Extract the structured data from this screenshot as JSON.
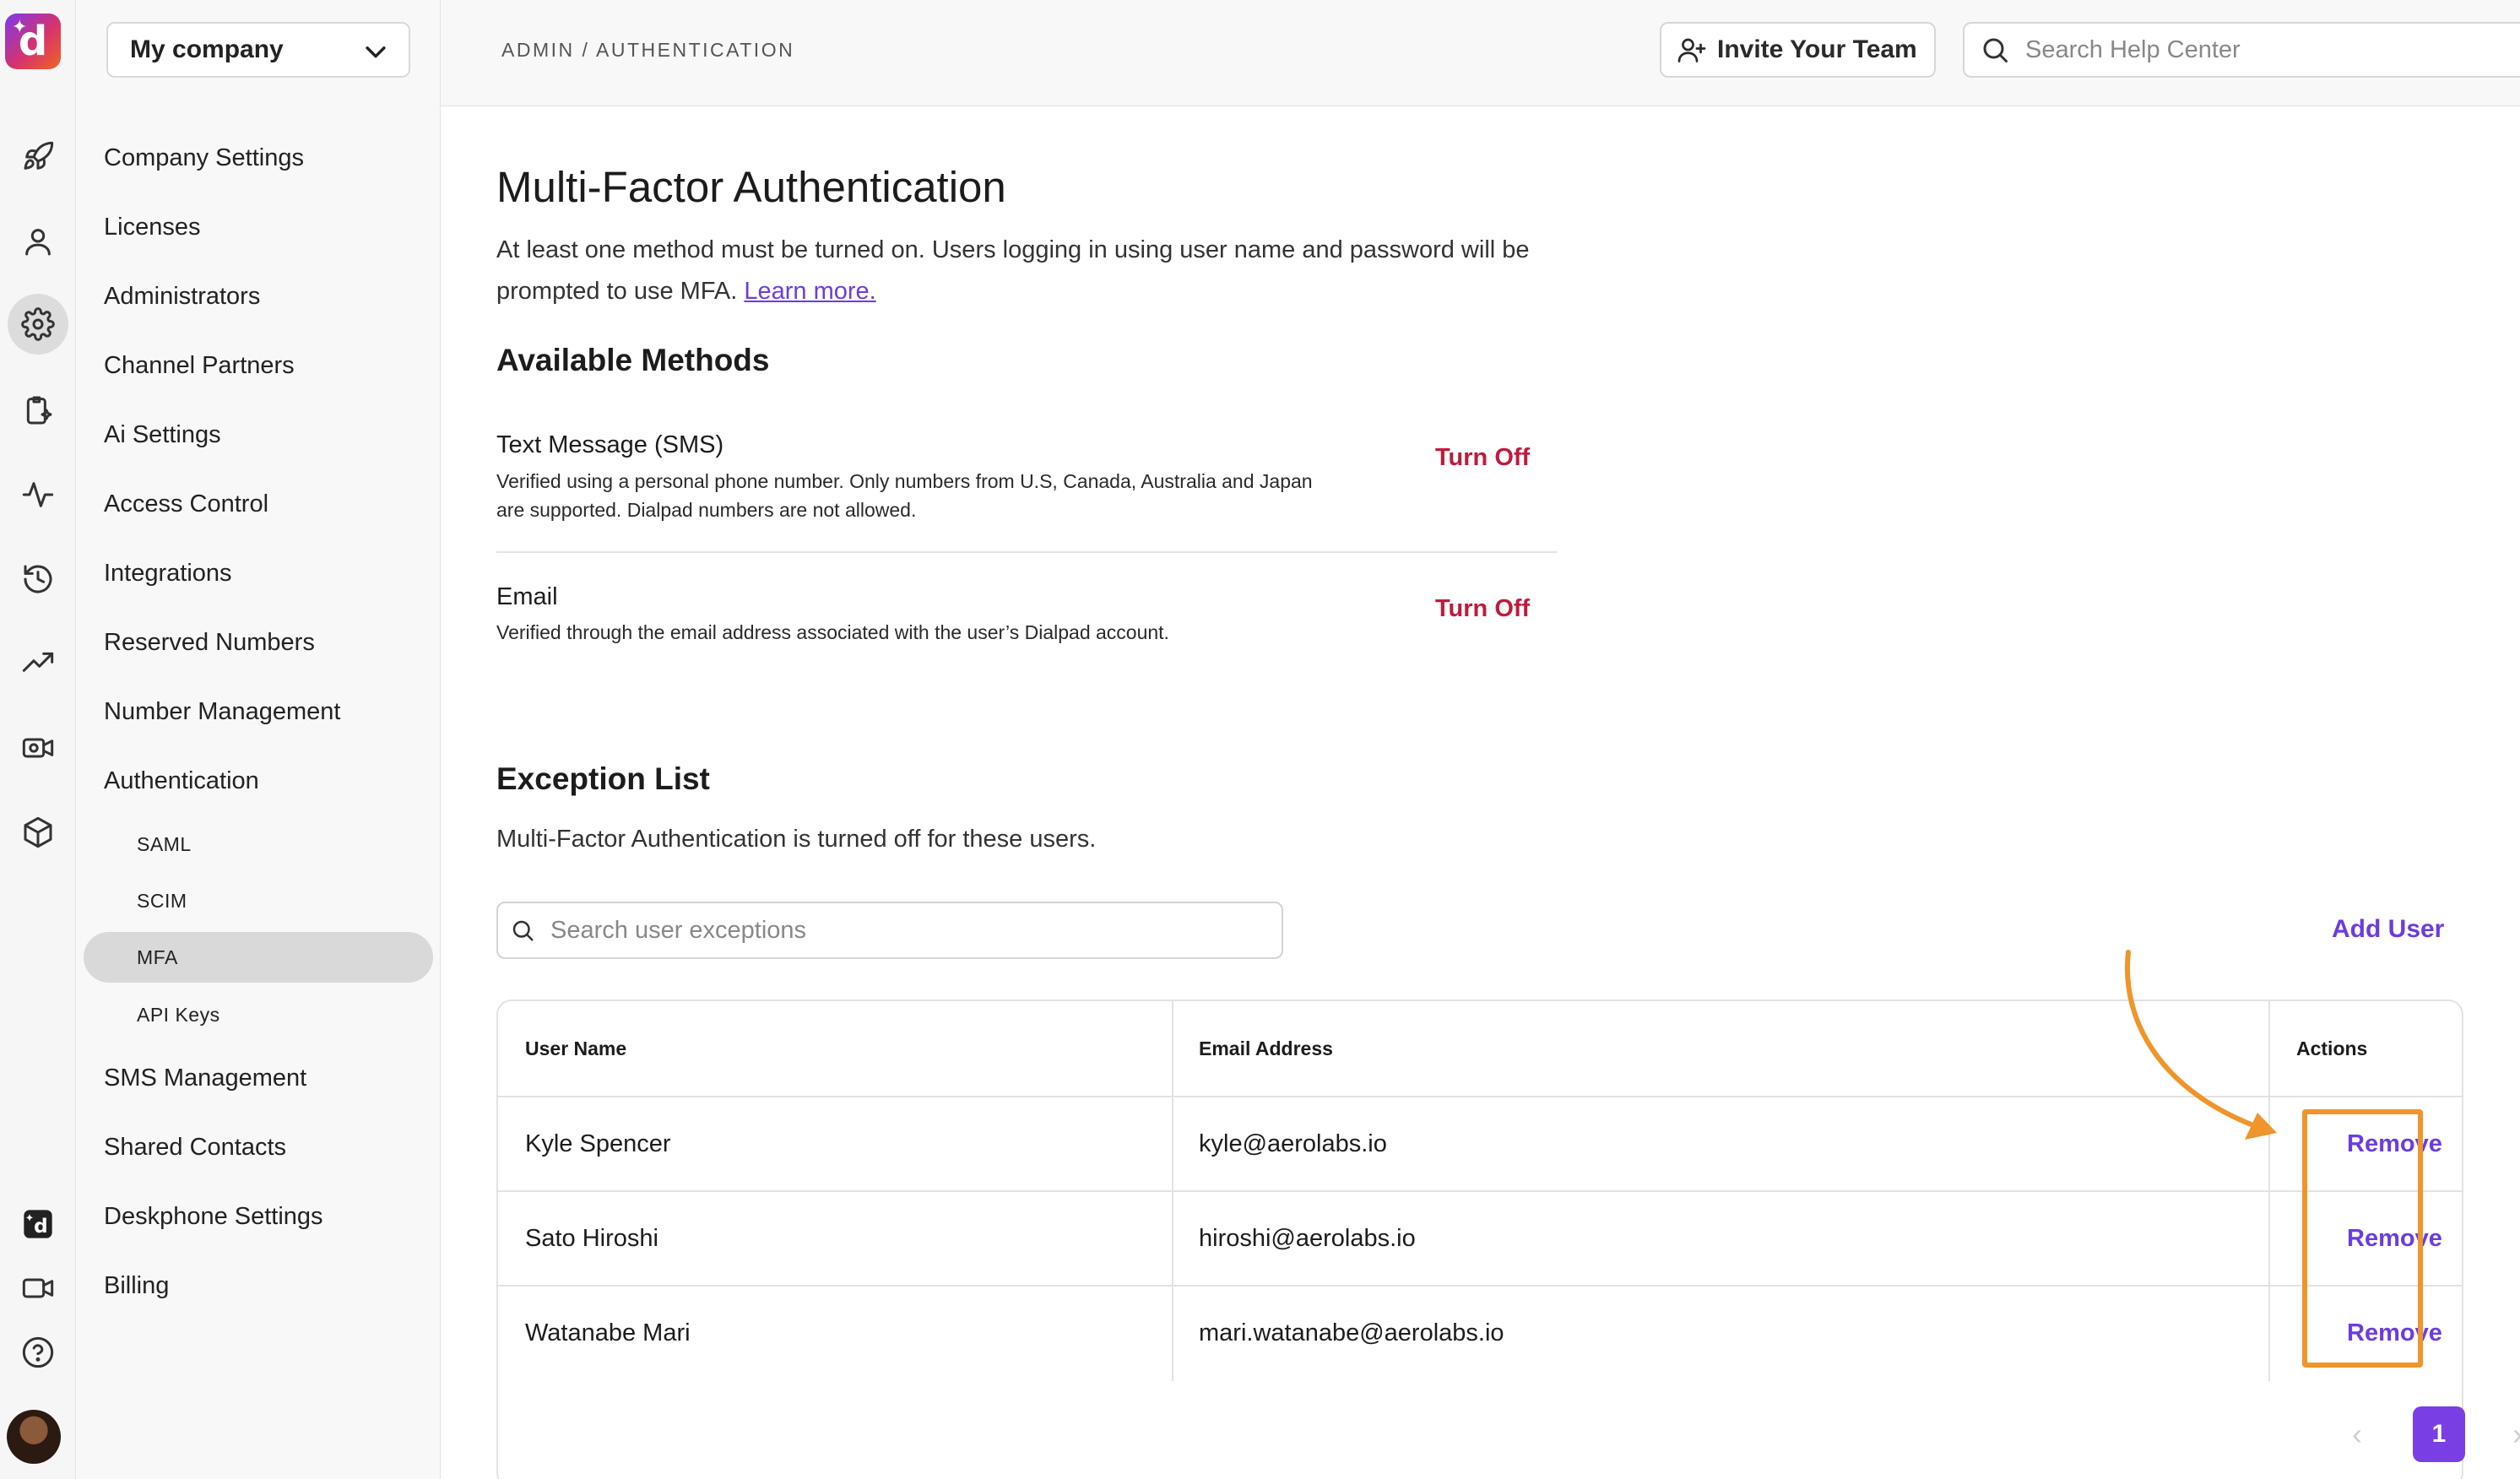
{
  "app": {
    "logo_letter": "d",
    "brand_gradient": [
      "#7c3aed",
      "#d6336c",
      "#f06423"
    ]
  },
  "rail": {
    "icons": [
      "rocket-icon",
      "user-icon",
      "gear-icon",
      "clipboard-sparkle-icon",
      "activity-icon",
      "history-icon",
      "trending-up-icon",
      "video-gear-icon",
      "cube-icon",
      "dialpad-logo-icon",
      "video-icon",
      "help-icon"
    ],
    "active": "gear-icon"
  },
  "sidebar": {
    "company": "My company",
    "items": [
      {
        "label": "Company Settings"
      },
      {
        "label": "Licenses"
      },
      {
        "label": "Administrators"
      },
      {
        "label": "Channel Partners"
      },
      {
        "label": "Ai Settings"
      },
      {
        "label": "Access Control"
      },
      {
        "label": "Integrations"
      },
      {
        "label": "Reserved Numbers"
      },
      {
        "label": "Number Management"
      },
      {
        "label": "Authentication"
      }
    ],
    "sub_items": [
      {
        "label": "SAML"
      },
      {
        "label": "SCIM"
      },
      {
        "label": "MFA"
      },
      {
        "label": "API Keys"
      }
    ],
    "items_after": [
      {
        "label": "SMS Management"
      },
      {
        "label": "Shared Contacts"
      },
      {
        "label": "Deskphone Settings"
      },
      {
        "label": "Billing"
      }
    ],
    "selected": "MFA"
  },
  "header": {
    "breadcrumb": "ADMIN / AUTHENTICATION",
    "invite_label": "Invite Your Team",
    "search_placeholder": "Search Help Center"
  },
  "main": {
    "title": "Multi-Factor Authentication",
    "description": "At least one method must be turned on. Users logging in using user name and password will be prompted to use MFA.",
    "learn_more": "Learn more.",
    "methods_title": "Available Methods",
    "methods": [
      {
        "name": "Text Message (SMS)",
        "description": "Verified using a personal phone number. Only numbers from U.S, Canada, Australia and Japan are supported. Dialpad numbers are not allowed.",
        "action": "Turn Off"
      },
      {
        "name": "Email",
        "description": "Verified through the email address associated with the user’s Dialpad account.",
        "action": "Turn Off"
      }
    ],
    "exception_title": "Exception List",
    "exception_description": "Multi-Factor Authentication is turned off for these users.",
    "exception_search_placeholder": "Search user exceptions",
    "add_user_label": "Add User",
    "table": {
      "columns": [
        "User Name",
        "Email Address",
        "Actions"
      ],
      "rows": [
        {
          "name": "Kyle Spencer",
          "email": "kyle@aerolabs.io",
          "action": "Remove"
        },
        {
          "name": "Sato Hiroshi",
          "email": "hiroshi@aerolabs.io",
          "action": "Remove"
        },
        {
          "name": "Watanabe Mari",
          "email": "mari.watanabe@aerolabs.io",
          "action": "Remove"
        }
      ]
    },
    "pagination": {
      "current_page": "1"
    }
  },
  "colors": {
    "accent": "#6c3ce0",
    "danger": "#c01a3c",
    "callout": "#f0952a",
    "page_active": "#7a3fe4"
  }
}
